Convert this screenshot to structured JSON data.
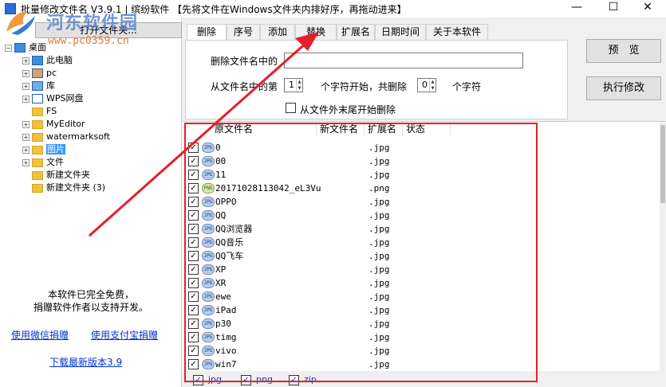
{
  "window": {
    "title": "批量修改文件名 V3.9.1 | 缤纷软件  【先将文件在Windows文件夹内排好序，再拖动进来】",
    "minimize_icon": "minimize-icon",
    "maximize_icon": "maximize-icon",
    "close_icon": "close-icon",
    "minimize_glyph": "—",
    "maximize_glyph": "☐",
    "close_glyph": "✕"
  },
  "watermark": {
    "name": "河东软件园",
    "url": "www.pc0359.cn"
  },
  "left": {
    "open_folder_button": "打开文件夹...",
    "tree": [
      {
        "label": "桌面",
        "level": 0,
        "expander": "-",
        "icon": "desktop-icon"
      },
      {
        "label": "此电脑",
        "level": 1,
        "expander": "+",
        "icon": "computer-icon"
      },
      {
        "label": "pc",
        "level": 1,
        "expander": "+",
        "icon": "user-icon"
      },
      {
        "label": "库",
        "level": 1,
        "expander": "+",
        "icon": "library-icon"
      },
      {
        "label": "WPS网盘",
        "level": 1,
        "expander": "+",
        "icon": "cloud-icon"
      },
      {
        "label": "FS",
        "level": 1,
        "expander": "",
        "icon": "folder-icon"
      },
      {
        "label": "MyEditor",
        "level": 1,
        "expander": "+",
        "icon": "folder-icon"
      },
      {
        "label": "watermarksoft",
        "level": 1,
        "expander": "+",
        "icon": "folder-icon"
      },
      {
        "label": "图片",
        "level": 1,
        "expander": "+",
        "icon": "folder-icon",
        "selected": true
      },
      {
        "label": "文件",
        "level": 1,
        "expander": "+",
        "icon": "folder-icon"
      },
      {
        "label": "新建文件夹",
        "level": 1,
        "expander": "",
        "icon": "folder-icon"
      },
      {
        "label": "新建文件夹 (3)",
        "level": 1,
        "expander": "",
        "icon": "folder-icon"
      }
    ],
    "free_note_line1": "本软件已完全免费，",
    "free_note_line2": "捐赠软件作者以支持开发。",
    "donate_wechat": "使用微信捐赠",
    "donate_alipay": "使用支付宝捐赠",
    "download_latest": "下载最新版本3.9"
  },
  "tabs": [
    "删除",
    "序号",
    "添加",
    "替换",
    "扩展名",
    "日期时间",
    "关于本软件"
  ],
  "delete_tab": {
    "delete_name_label": "删除文件名中的",
    "delete_name_value": "",
    "from_start_label": "从文件名中的第",
    "start_pos": "1",
    "start_suffix_label": "个字符开始，共删除",
    "count": "0",
    "count_suffix_label": "个字符",
    "from_end_label": "从文件外末尾开始删除",
    "from_end_checked": false
  },
  "buttons": {
    "preview": "预　览",
    "execute": "执行修改"
  },
  "file_list": {
    "columns": [
      "原文件名",
      "新文件名",
      "扩展名",
      "状态"
    ],
    "rows": [
      {
        "name": "0",
        "new": "",
        "ext": ".jpg",
        "status": "",
        "type": "jpg"
      },
      {
        "name": "00",
        "new": "",
        "ext": ".jpg",
        "status": "",
        "type": "jpg"
      },
      {
        "name": "11",
        "new": "",
        "ext": ".jpg",
        "status": "",
        "type": "jpg"
      },
      {
        "name": "20171028113042_eL3Vu",
        "new": "",
        "ext": ".png",
        "status": "",
        "type": "png"
      },
      {
        "name": "OPPO",
        "new": "",
        "ext": ".jpg",
        "status": "",
        "type": "jpg"
      },
      {
        "name": "QQ",
        "new": "",
        "ext": ".jpg",
        "status": "",
        "type": "jpg"
      },
      {
        "name": "QQ浏览器",
        "new": "",
        "ext": ".jpg",
        "status": "",
        "type": "jpg"
      },
      {
        "name": "QQ音乐",
        "new": "",
        "ext": ".jpg",
        "status": "",
        "type": "jpg"
      },
      {
        "name": "QQ飞车",
        "new": "",
        "ext": ".jpg",
        "status": "",
        "type": "jpg"
      },
      {
        "name": "XP",
        "new": "",
        "ext": ".jpg",
        "status": "",
        "type": "jpg"
      },
      {
        "name": "XR",
        "new": "",
        "ext": ".jpg",
        "status": "",
        "type": "jpg"
      },
      {
        "name": "ewe",
        "new": "",
        "ext": ".jpg",
        "status": "",
        "type": "jpg"
      },
      {
        "name": "iPad",
        "new": "",
        "ext": ".jpg",
        "status": "",
        "type": "jpg"
      },
      {
        "name": "p30",
        "new": "",
        "ext": ".jpg",
        "status": "",
        "type": "jpg"
      },
      {
        "name": "timg",
        "new": "",
        "ext": ".jpg",
        "status": "",
        "type": "jpg"
      },
      {
        "name": "vivo",
        "new": "",
        "ext": ".jpg",
        "status": "",
        "type": "jpg"
      },
      {
        "name": "win7",
        "new": "",
        "ext": ".jpg",
        "status": "",
        "type": "jpg"
      }
    ],
    "icon_label_jpg": "JPG",
    "icon_label_png": "PNG"
  },
  "filters": [
    {
      "label": "jpg",
      "checked": true
    },
    {
      "label": "png",
      "checked": true
    },
    {
      "label": "zip",
      "checked": true
    }
  ],
  "colors": {
    "annotation_red": "#e5202a",
    "selection_blue": "#3399ff",
    "link_blue": "#0033cc"
  }
}
